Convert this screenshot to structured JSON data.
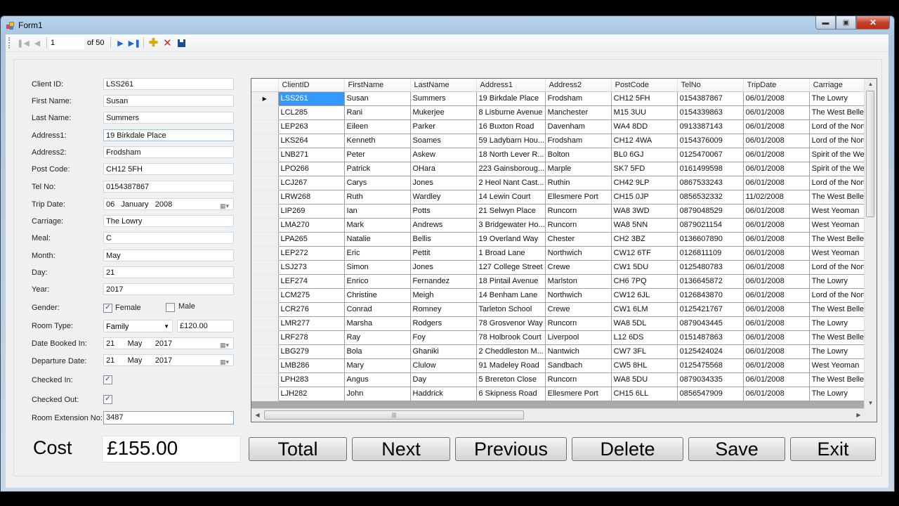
{
  "window": {
    "title": "Form1"
  },
  "navigator": {
    "position": "1",
    "of_label": "of 50",
    "icons": [
      "move-first-icon",
      "move-previous-icon",
      "move-next-icon",
      "move-last-icon",
      "add-new-icon",
      "delete-icon",
      "save-icon"
    ]
  },
  "form": {
    "labels": {
      "client_id": "Client ID:",
      "first_name": "First Name:",
      "last_name": "Last Name:",
      "address1": "Address1:",
      "address2": "Address2:",
      "post_code": "Post Code:",
      "tel_no": "Tel No:",
      "trip_date": "Trip Date:",
      "carriage": "Carriage:",
      "meal": "Meal:",
      "month": "Month:",
      "day": "Day:",
      "year": "Year:",
      "gender": "Gender:",
      "room_type": "Room Type:",
      "date_booked_in": "Date Booked In:",
      "departure_date": "Departure Date:",
      "checked_in": "Checked In:",
      "checked_out": "Checked Out:",
      "room_extension": "Room Extension No:"
    },
    "values": {
      "client_id": "LSS261",
      "first_name": "Susan",
      "last_name": "Summers",
      "address1": "19 Birkdale Place",
      "address2": "Frodsham",
      "post_code": "CH12 5FH",
      "tel_no": "0154387867",
      "trip_date": {
        "day": "06",
        "month": "January",
        "year": "2008"
      },
      "carriage": "The Lowry",
      "meal": "C",
      "month": "May",
      "day": "21",
      "year": "2017",
      "gender_female_label": "Female",
      "gender_male_label": "Male",
      "gender_female_checked": true,
      "gender_male_checked": false,
      "room_type": "Family",
      "room_price": "£120.00",
      "date_booked_in": {
        "day": "21",
        "month": "May",
        "year": "2017"
      },
      "departure_date": {
        "day": "21",
        "month": "May",
        "year": "2017"
      },
      "checked_in": true,
      "checked_out": true,
      "room_extension": "3487"
    }
  },
  "grid": {
    "columns": [
      "ClientID",
      "FirstName",
      "LastName",
      "Address1",
      "Address2",
      "PostCode",
      "TelNo",
      "TripDate",
      "Carriage"
    ],
    "selected_row": 0,
    "rows": [
      [
        "LSS261",
        "Susan",
        "Summers",
        "19 Birkdale Place",
        "Frodsham",
        "CH12 5FH",
        "0154387867",
        "06/01/2008",
        "The Lowry"
      ],
      [
        "LCL285",
        "Rani",
        "Mukerjee",
        "8 Lisburne Avenue",
        "Manchester",
        "M15 3UU",
        "0154339863",
        "06/01/2008",
        "The West Belle"
      ],
      [
        "LEP263",
        "Eileen",
        "Parker",
        "16 Buxton Road",
        "Davenham",
        "WA4 8DD",
        "0913387143",
        "06/01/2008",
        "Lord of the North"
      ],
      [
        "LKS264",
        "Kenneth",
        "Soames",
        "59 Ladybarn Hou...",
        "Frodsham",
        "CH12 4WA",
        "0154376009",
        "06/01/2008",
        "Lord of the North"
      ],
      [
        "LNB271",
        "Peter",
        "Askew",
        "18 North Lever R...",
        "Bolton",
        "BL0 6GJ",
        "0125470067",
        "06/01/2008",
        "Spirit of the West"
      ],
      [
        "LPO266",
        "Patrick",
        "OHara",
        "223 Gainsboroug...",
        "Marple",
        "SK7 5FD",
        "0161499598",
        "06/01/2008",
        "Spirit of the West"
      ],
      [
        "LCJ267",
        "Carys",
        "Jones",
        "2 Heol Nant Cast...",
        "Ruthin",
        "CH42 9LP",
        "0867533243",
        "06/01/2008",
        "Lord of the North"
      ],
      [
        "LRW268",
        "Ruth",
        "Wardley",
        "14 Lewin Court",
        "Ellesmere Port",
        "CH15 0JP",
        "0856532332",
        "11/02/2008",
        "The West Belle"
      ],
      [
        "LIP269",
        "Ian",
        "Potts",
        "21 Selwyn Place",
        "Runcorn",
        "WA8 3WD",
        "0879048529",
        "06/01/2008",
        "West Yeoman"
      ],
      [
        "LMA270",
        "Mark",
        "Andrews",
        "3 Bridgewater Ho...",
        "Runcorn",
        "WA8 5NN",
        "0879021154",
        "06/01/2008",
        "West Yeoman"
      ],
      [
        "LPA265",
        "Natalie",
        "Bellis",
        "19 Overland Way",
        "Chester",
        "CH2 3BZ",
        "0136607890",
        "06/01/2008",
        "The West Belle"
      ],
      [
        "LEP272",
        "Eric",
        "Pettit",
        "1 Broad Lane",
        "Northwich",
        "CW12 6TF",
        "0126811109",
        "06/01/2008",
        "West Yeoman"
      ],
      [
        "LSJ273",
        "Simon",
        "Jones",
        "127 College Street",
        "Crewe",
        "CW1 5DU",
        "0125480783",
        "06/01/2008",
        "Lord of the North"
      ],
      [
        "LEF274",
        "Enrico",
        "Fernandez",
        "18 Pintail Avenue",
        "Marlston",
        "CH6 7PQ",
        "0136645872",
        "06/01/2008",
        "The Lowry"
      ],
      [
        "LCM275",
        "Christine",
        "Meigh",
        "14 Benham Lane",
        "Northwich",
        "CW12 6JL",
        "0126843870",
        "06/01/2008",
        "Lord of the North"
      ],
      [
        "LCR276",
        "Conrad",
        "Romney",
        "Tarleton School",
        "Crewe",
        "CW1 6LM",
        "0125421767",
        "06/01/2008",
        "The West Belle"
      ],
      [
        "LMR277",
        "Marsha",
        "Rodgers",
        "78 Grosvenor Way",
        "Runcorn",
        "WA8 5DL",
        "0879043445",
        "06/01/2008",
        "The Lowry"
      ],
      [
        "LRF278",
        "Ray",
        "Foy",
        "78 Holbrook Court",
        "Liverpool",
        "L12 6DS",
        "0151487863",
        "06/01/2008",
        "The West Belle"
      ],
      [
        "LBG279",
        "Bola",
        "Ghaniki",
        "2 Cheddleston M...",
        "Nantwich",
        "CW7 3FL",
        "0125424024",
        "06/01/2008",
        "The Lowry"
      ],
      [
        "LMB286",
        "Mary",
        "Clulow",
        "91 Madeley Road",
        "Sandbach",
        "CW5 8HL",
        "0125475568",
        "06/01/2008",
        "West Yeoman"
      ],
      [
        "LPH283",
        "Angus",
        "Day",
        "5 Brereton Close",
        "Runcorn",
        "WA8 5DU",
        "0879034335",
        "06/01/2008",
        "The West Belle"
      ],
      [
        "LJH282",
        "John",
        "Haddrick",
        "6 Skipness Road",
        "Ellesmere Port",
        "CH15 6LL",
        "0856547909",
        "06/01/2008",
        "The Lowry"
      ]
    ]
  },
  "footer": {
    "cost_label": "Cost",
    "cost_value": "£155.00",
    "buttons": {
      "total": "Total",
      "next": "Next",
      "previous": "Previous",
      "delete": "Delete",
      "save": "Save",
      "exit": "Exit"
    }
  }
}
